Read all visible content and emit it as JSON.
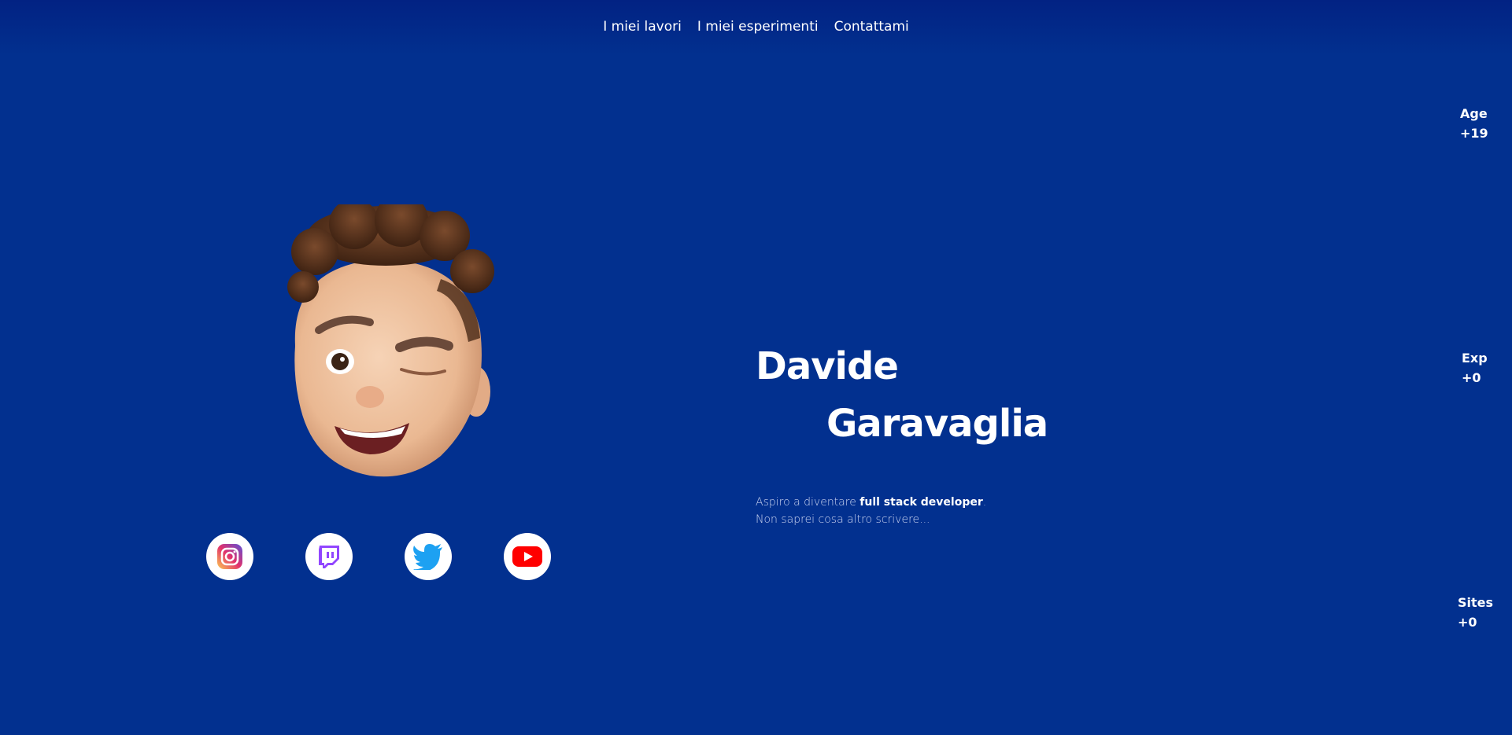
{
  "nav": {
    "items": [
      "I miei lavori",
      "I miei esperimenti",
      "Contattami"
    ]
  },
  "stats": [
    {
      "label": "Age",
      "value": "+19"
    },
    {
      "label": "Exp",
      "value": "+0"
    },
    {
      "label": "Sites",
      "value": "+0"
    }
  ],
  "hero": {
    "first_name": "Davide",
    "last_name": "Garavaglia",
    "bio_prefix": "Aspiro a diventare ",
    "bio_highlight": "full stack developer",
    "bio_suffix": ".",
    "bio_line2": "Non saprei cosa altro scrivere..."
  },
  "social": [
    {
      "icon": "instagram-icon"
    },
    {
      "icon": "twitch-icon"
    },
    {
      "icon": "twitter-icon"
    },
    {
      "icon": "youtube-icon"
    }
  ],
  "colors": {
    "background": "#02308f",
    "header_gradient_top": "#022283",
    "text": "#ffffff",
    "instagram": "#e1306c",
    "twitch": "#9146ff",
    "twitter": "#1da1f2",
    "youtube": "#ff0000"
  }
}
